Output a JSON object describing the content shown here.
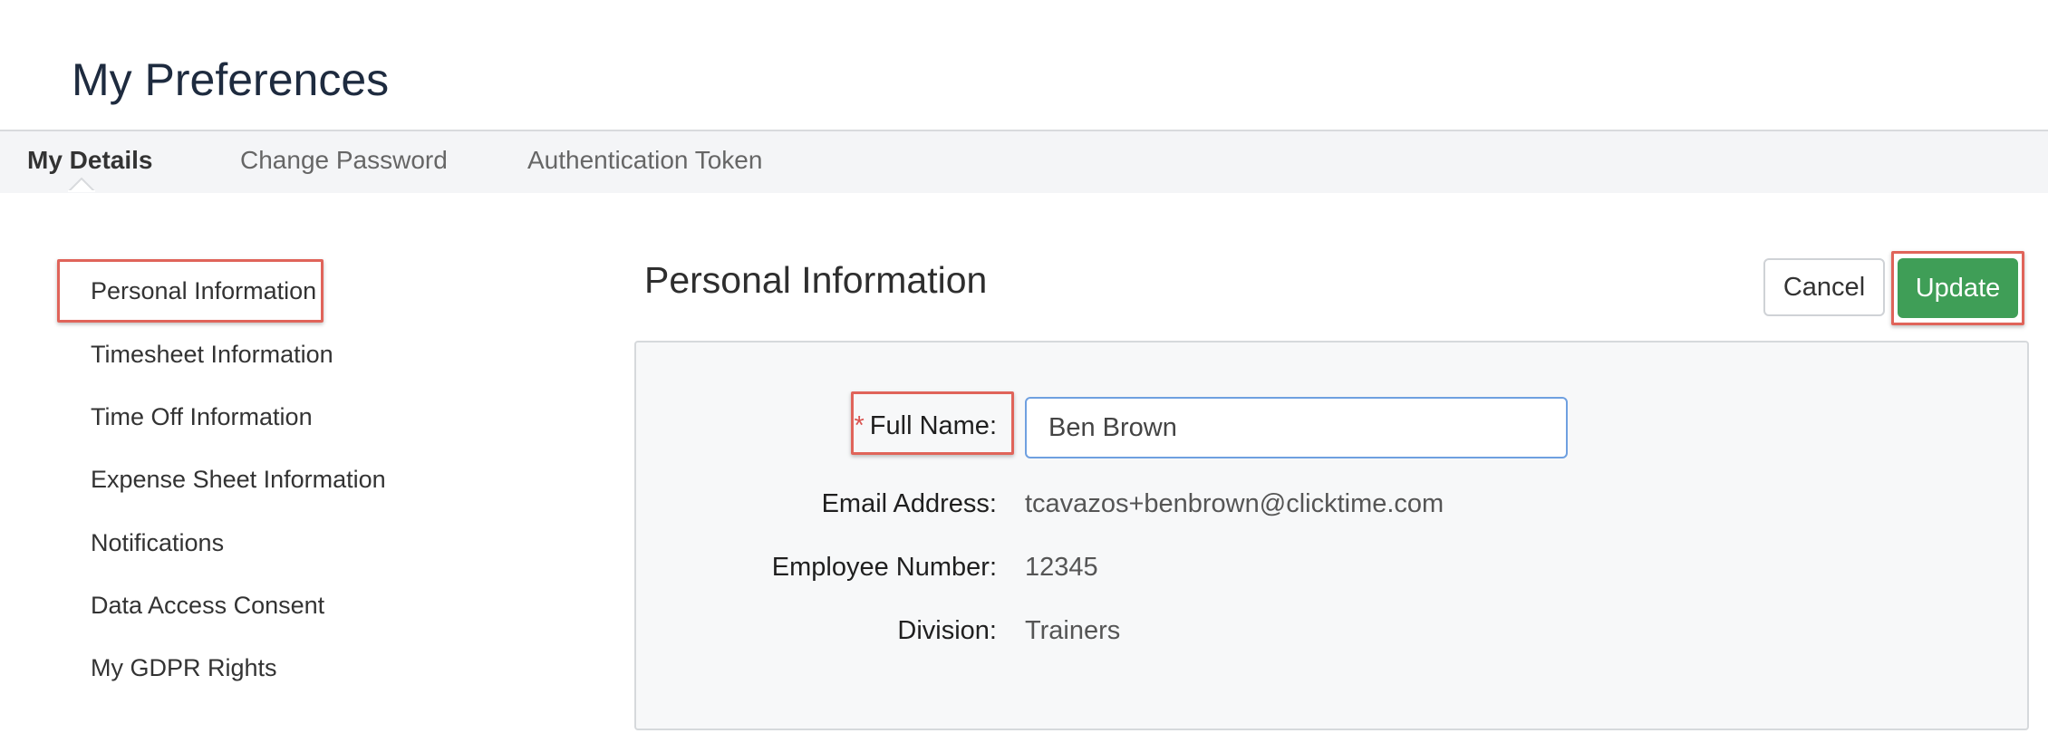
{
  "page": {
    "title": "My Preferences"
  },
  "tabs": [
    {
      "label": "My Details",
      "active": true
    },
    {
      "label": "Change Password",
      "active": false
    },
    {
      "label": "Authentication Token",
      "active": false
    }
  ],
  "sidebar": {
    "items": [
      {
        "label": "Personal Information",
        "highlighted": true
      },
      {
        "label": "Timesheet Information"
      },
      {
        "label": "Time Off Information"
      },
      {
        "label": "Expense Sheet Information"
      },
      {
        "label": "Notifications"
      },
      {
        "label": "Data Access Consent"
      },
      {
        "label": "My GDPR Rights"
      }
    ]
  },
  "section": {
    "title": "Personal Information",
    "cancel_label": "Cancel",
    "update_label": "Update"
  },
  "form": {
    "full_name": {
      "required_mark": "*",
      "label": "Full Name:",
      "value": "Ben Brown"
    },
    "email": {
      "label": "Email Address:",
      "value": "tcavazos+benbrown@clicktime.com"
    },
    "employee_number": {
      "label": "Employee Number:",
      "value": "12345"
    },
    "division": {
      "label": "Division:",
      "value": "Trainers"
    }
  },
  "colors": {
    "title": "#1e2b3f",
    "tab_bar": "#f4f5f7",
    "update_button": "#3f9e57",
    "highlight_box": "#e0645a",
    "input_border": "#6fa0e0",
    "required_star": "#d9534f"
  }
}
